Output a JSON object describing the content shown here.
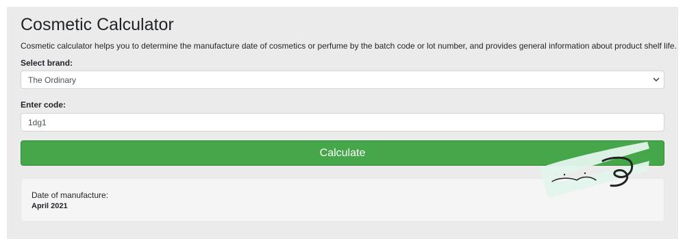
{
  "page": {
    "title": "Cosmetic Calculator",
    "description": "Cosmetic calculator helps you to determine the manufacture date of cosmetics or perfume by the batch code or lot number, and provides general information about product shelf life."
  },
  "form": {
    "brand_label": "Select brand:",
    "brand_value": "The Ordinary",
    "code_label": "Enter code:",
    "code_value": "1dg1",
    "calculate_label": "Calculate"
  },
  "result": {
    "label": "Date of manufacture:",
    "value": "April 2021"
  },
  "colors": {
    "button": "#46a74a",
    "panel": "#ebebeb",
    "result_box": "#f5f5f5"
  },
  "icons": {
    "select_arrow": "chevron-down-icon",
    "watermark": "logo-watermark"
  }
}
